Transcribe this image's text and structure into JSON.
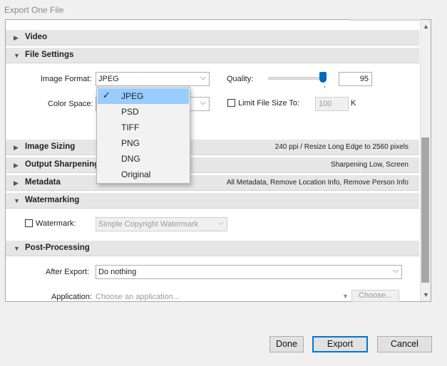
{
  "window": {
    "title": "Export One File"
  },
  "sections": {
    "video": {
      "title": "Video"
    },
    "file_settings": {
      "title": "File Settings",
      "image_format_label": "Image Format:",
      "image_format_value": "JPEG",
      "quality_label": "Quality:",
      "quality_value": "95",
      "color_space_label": "Color Space:",
      "limit_label": "Limit File Size To:",
      "limit_value": "100",
      "limit_unit": "K"
    },
    "image_sizing": {
      "title": "Image Sizing",
      "summary": "240 ppi / Resize Long Edge to 2560 pixels"
    },
    "output_sharpening": {
      "title": "Output Sharpening",
      "summary": "Sharpening Low, Screen"
    },
    "metadata": {
      "title": "Metadata",
      "summary": "All Metadata, Remove Location Info, Remove Person Info"
    },
    "watermarking": {
      "title": "Watermarking",
      "watermark_label": "Watermark:",
      "watermark_value": "Simple Copyright Watermark"
    },
    "post_processing": {
      "title": "Post-Processing",
      "after_export_label": "After Export:",
      "after_export_value": "Do nothing",
      "application_label": "Application:",
      "application_placeholder": "Choose an application...",
      "choose_button": "Choose..."
    }
  },
  "format_menu": {
    "items": [
      "JPEG",
      "PSD",
      "TIFF",
      "PNG",
      "DNG",
      "Original"
    ],
    "selected": "JPEG"
  },
  "buttons": {
    "done": "Done",
    "export": "Export",
    "cancel": "Cancel"
  },
  "icons": {
    "expanded": "triangle-down-icon",
    "collapsed": "triangle-right-icon",
    "check": "checkmark-icon"
  },
  "colors": {
    "accent": "#0078d7",
    "menu_selected": "#99ccff",
    "slider": "#0067c0"
  }
}
